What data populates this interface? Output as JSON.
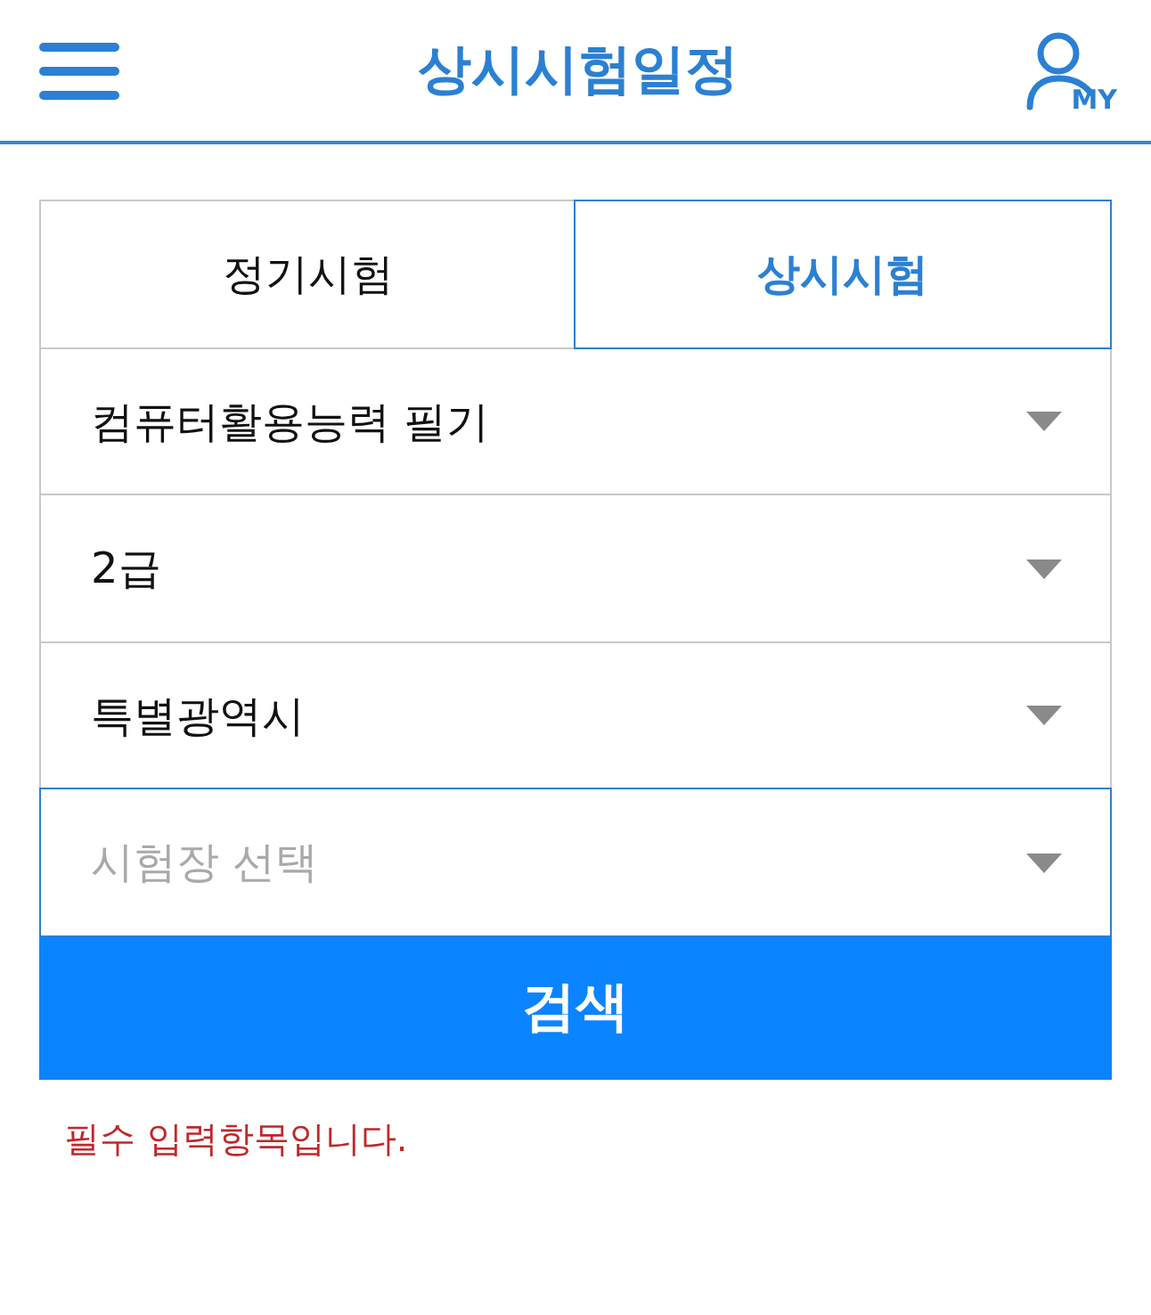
{
  "header": {
    "title": "상시시험일정",
    "account_label": "MY"
  },
  "tabs": [
    {
      "label": "정기시험",
      "selected": false
    },
    {
      "label": "상시시험",
      "selected": true
    }
  ],
  "selects": [
    {
      "value": "컴퓨터활용능력 필기",
      "focused": false
    },
    {
      "value": "2급",
      "focused": false
    },
    {
      "value": "특별광역시",
      "focused": false
    },
    {
      "placeholder": "시험장 선택",
      "focused": true
    }
  ],
  "search_button": "검색",
  "error_message": "필수 입력항목입니다."
}
